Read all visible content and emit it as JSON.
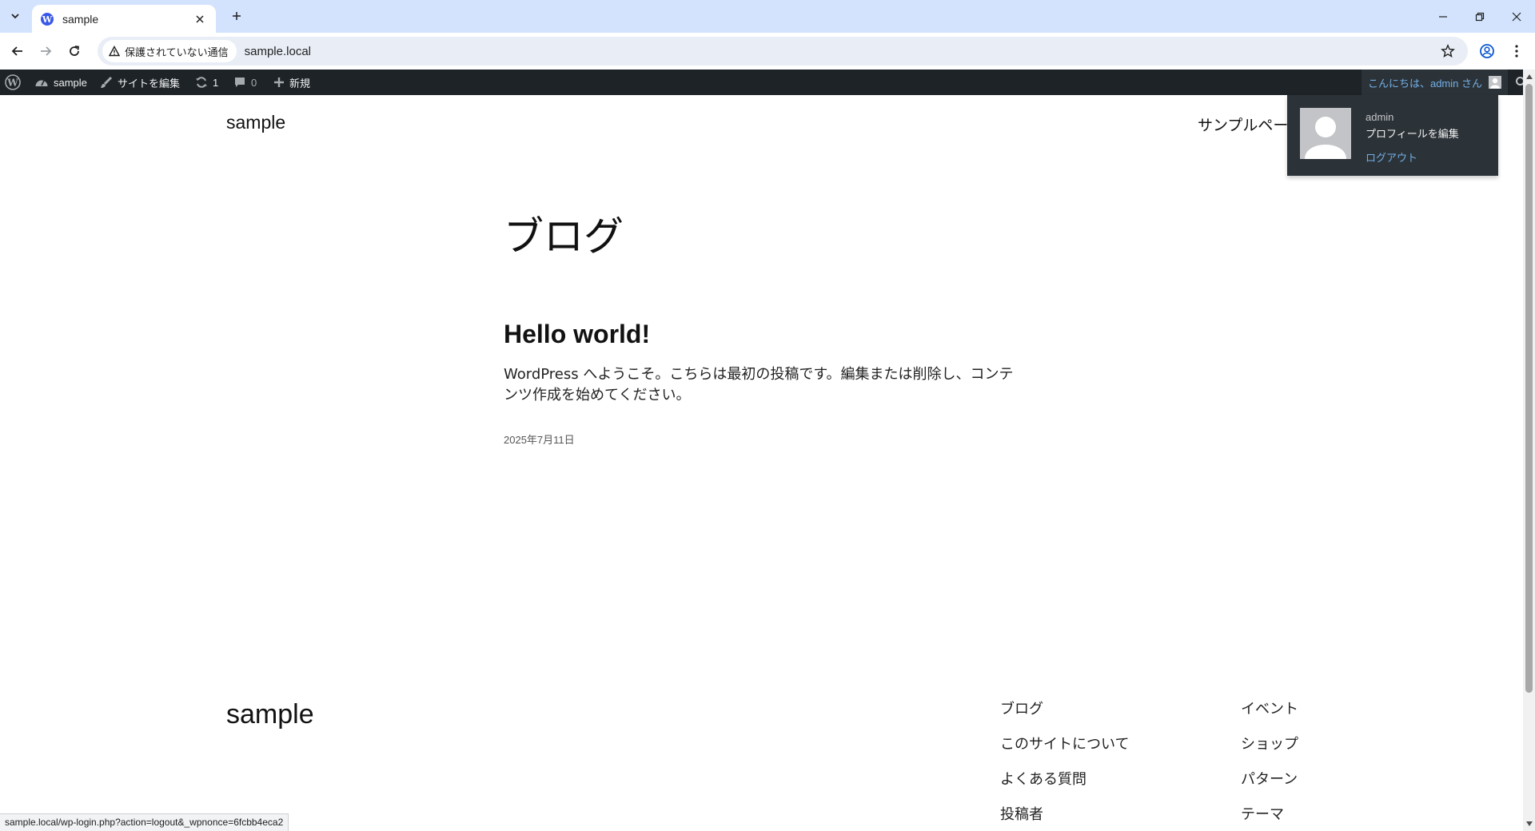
{
  "browser": {
    "tab_title": "sample",
    "security_label": "保護されていない通信",
    "url": "sample.local",
    "status_url": "sample.local/wp-login.php?action=logout&_wpnonce=6fcbb4eca2"
  },
  "adminbar": {
    "site_name": "sample",
    "edit_site": "サイトを編集",
    "updates_count": "1",
    "comments_count": "0",
    "new_label": "新規",
    "greeting": "こんにちは、admin さん"
  },
  "account_menu": {
    "username": "admin",
    "edit_profile": "プロフィールを編集",
    "logout": "ログアウト"
  },
  "site": {
    "title": "sample",
    "nav_item": "サンプルページ",
    "page_heading": "ブログ"
  },
  "post": {
    "title": "Hello world!",
    "excerpt": "WordPress へようこそ。こちらは最初の投稿です。編集または削除し、コンテンツ作成を始めてください。",
    "date": "2025年7月11日"
  },
  "footer": {
    "title": "sample",
    "col1": [
      "ブログ",
      "このサイトについて",
      "よくある質問",
      "投稿者"
    ],
    "col2": [
      "イベント",
      "ショップ",
      "パターン",
      "テーマ"
    ]
  },
  "colors": {
    "tabbar_bg": "#d3e3fd",
    "adminbar_bg": "#1d2327",
    "adminbar_link": "#72aee6"
  }
}
